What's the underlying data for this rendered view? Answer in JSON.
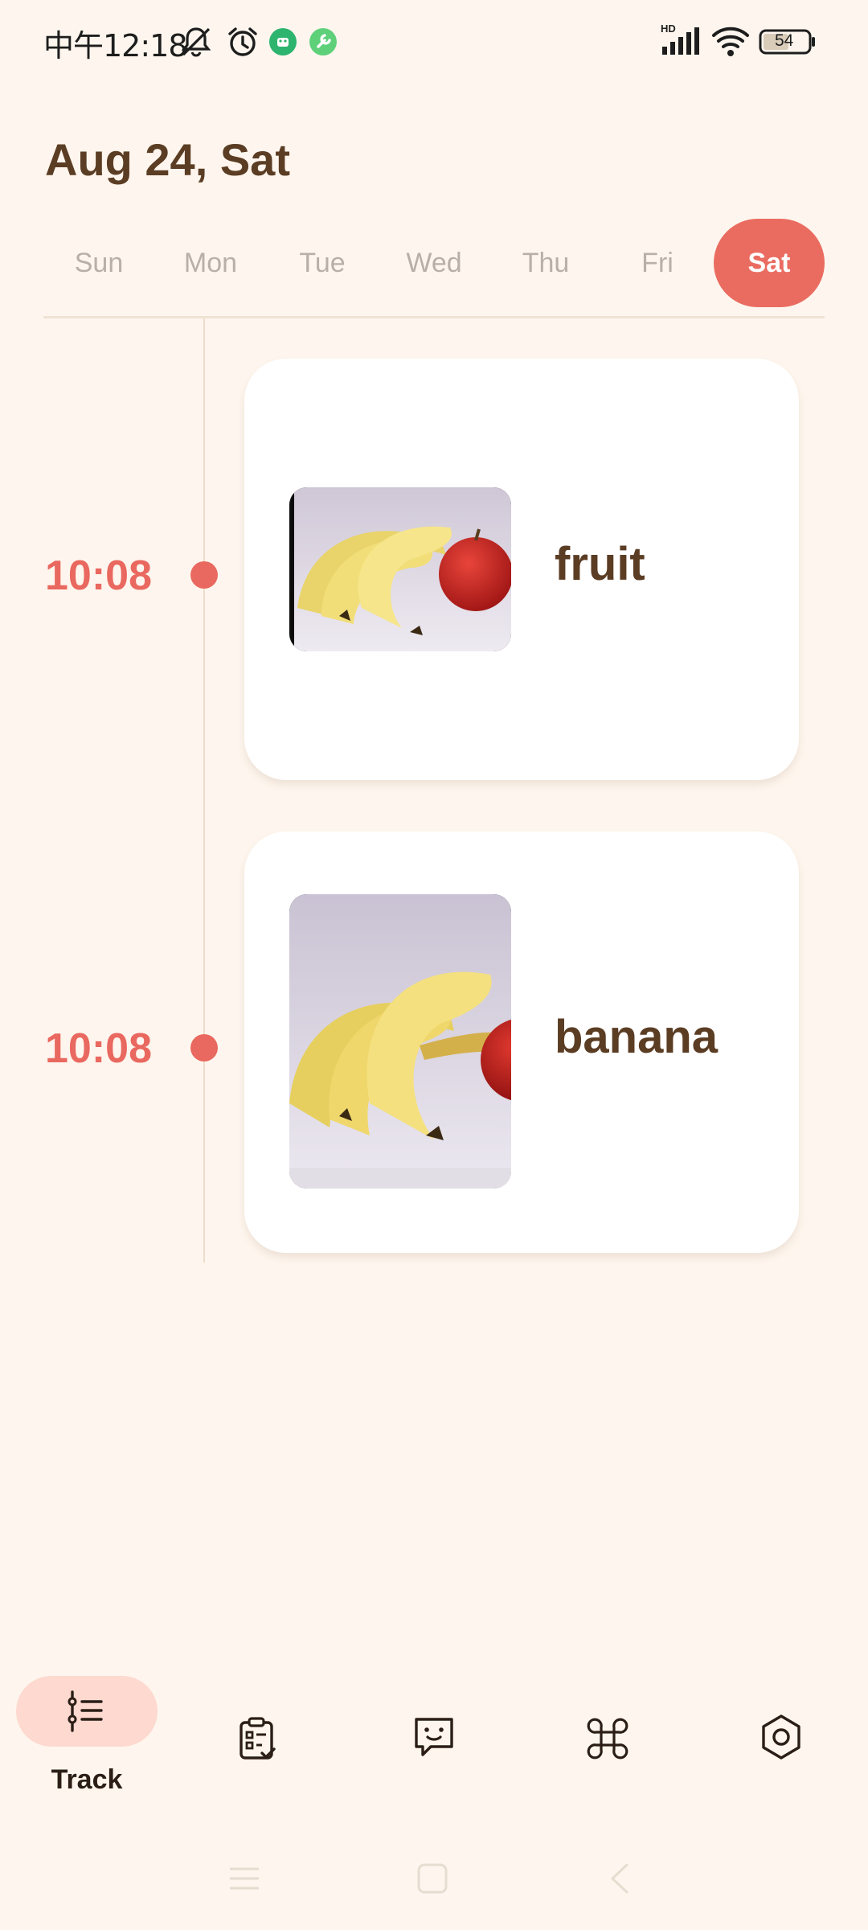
{
  "status_bar": {
    "time": "中午12:18",
    "battery": "54",
    "network_label": "HD",
    "icons": [
      "notifications-off-icon",
      "alarm-icon",
      "app-notification-icon",
      "tool-notification-icon",
      "signal-icon",
      "wifi-icon",
      "battery-icon"
    ]
  },
  "header": {
    "date": "Aug 24, Sat"
  },
  "week": {
    "days": [
      "Sun",
      "Mon",
      "Tue",
      "Wed",
      "Thu",
      "Fri",
      "Sat"
    ],
    "selected": "Sat"
  },
  "timeline": {
    "entries": [
      {
        "time": "10:08",
        "label": "fruit",
        "photo": "bananas-and-apple-photo"
      },
      {
        "time": "10:08",
        "label": "banana",
        "photo": "bananas-and-apple-photo"
      }
    ]
  },
  "bottom_nav": {
    "items": [
      {
        "label": "Track",
        "icon": "track-list-icon",
        "active": true
      },
      {
        "label": "",
        "icon": "checklist-icon",
        "active": false
      },
      {
        "label": "",
        "icon": "chat-smile-icon",
        "active": false
      },
      {
        "label": "",
        "icon": "command-icon",
        "active": false
      },
      {
        "label": "",
        "icon": "settings-hexagon-icon",
        "active": false
      }
    ]
  },
  "system_nav": {
    "icons": [
      "menu-icon",
      "home-icon",
      "back-icon"
    ]
  },
  "colors": {
    "background": "#FEF6EE",
    "accent": "#EA6C61",
    "text_brown": "#5B3D24",
    "nav_pill": "#FDD9D0",
    "inactive_day": "#B8B0A8"
  }
}
